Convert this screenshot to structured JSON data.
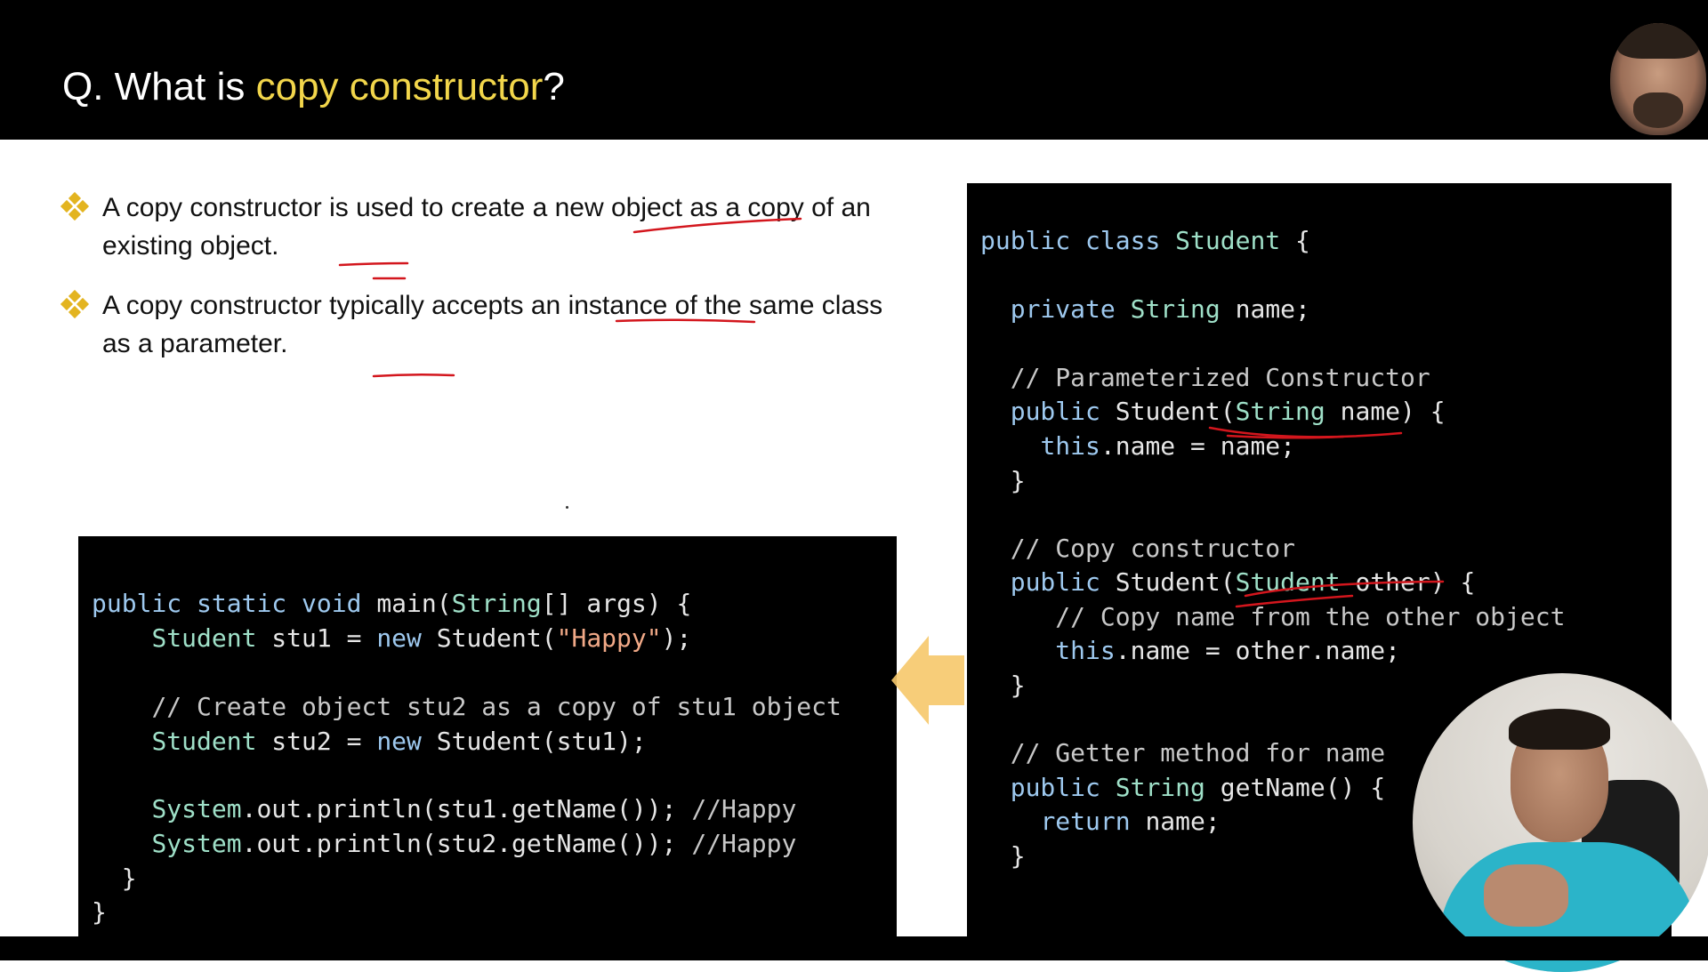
{
  "slide": {
    "title_prefix": "Q. What is ",
    "title_highlight": "copy constructor",
    "title_suffix": "?",
    "bullets": [
      "A copy constructor is used to create a new object as a copy of an existing object.",
      "A copy constructor typically accepts an instance of the same class as a parameter."
    ]
  },
  "main_code": {
    "l1": {
      "a": "public",
      "b": " ",
      "c": "static",
      "d": " ",
      "e": "void",
      "f": " main(",
      "g": "String",
      "h": "[] args) {"
    },
    "l2": {
      "indent": "    ",
      "t": "Student",
      "a": " stu1 = ",
      "n": "new",
      "b": " Student(",
      "s": "\"Happy\"",
      "c": ");"
    },
    "l3": {
      "indent": "    ",
      "c": "// Create object stu2 as a copy of stu1 object"
    },
    "l4": {
      "indent": "    ",
      "t": "Student",
      "a": " stu2 = ",
      "n": "new",
      "b": " Student(stu1);"
    },
    "l5": {
      "indent": "    ",
      "t": "System",
      "a": ".out.println(stu1.getName()); ",
      "c": "//Happy"
    },
    "l6": {
      "indent": "    ",
      "t": "System",
      "a": ".out.println(stu2.getName()); ",
      "c": "//Happy"
    },
    "l7": "  }",
    "l8": "}"
  },
  "class_code": {
    "l1": {
      "a": "public",
      "b": " ",
      "c": "class",
      "d": " ",
      "e": "Student",
      "f": " {"
    },
    "l2": {
      "indent": "  ",
      "a": "private",
      "b": " ",
      "c": "String",
      "d": " name;"
    },
    "l3": "  // Parameterized Constructor",
    "l4": {
      "indent": "  ",
      "a": "public",
      "b": " Student(",
      "c": "String",
      "d": " name) {"
    },
    "l5": {
      "indent": "    ",
      "a": "this",
      "b": ".name = name;"
    },
    "l6": "  }",
    "l7": "  // Copy constructor",
    "l8": {
      "indent": "  ",
      "a": "public",
      "b": " Student(",
      "c": "Student",
      "d": " other) {"
    },
    "l9": "     // Copy name from the other object",
    "l10": {
      "indent": "     ",
      "a": "this",
      "b": ".name = other.name;"
    },
    "l11": "  }",
    "l12": "  // Getter method for name",
    "l13": {
      "indent": "  ",
      "a": "public",
      "b": " ",
      "c": "String",
      "d": " getName() {"
    },
    "l14": {
      "indent": "    ",
      "a": "return",
      "b": " name;"
    },
    "l15": "  }"
  },
  "colors": {
    "title_highlight": "#f2d64b",
    "keyword": "#9ec9ef",
    "type": "#9fe0c8",
    "string": "#f1a987",
    "ink": "#d3161d",
    "arrow": "#f6c86a",
    "bullet_icon": "#e3b420"
  },
  "icons": {
    "bullet": "four-diamond-bullet-icon",
    "arrow": "left-arrow-icon"
  }
}
